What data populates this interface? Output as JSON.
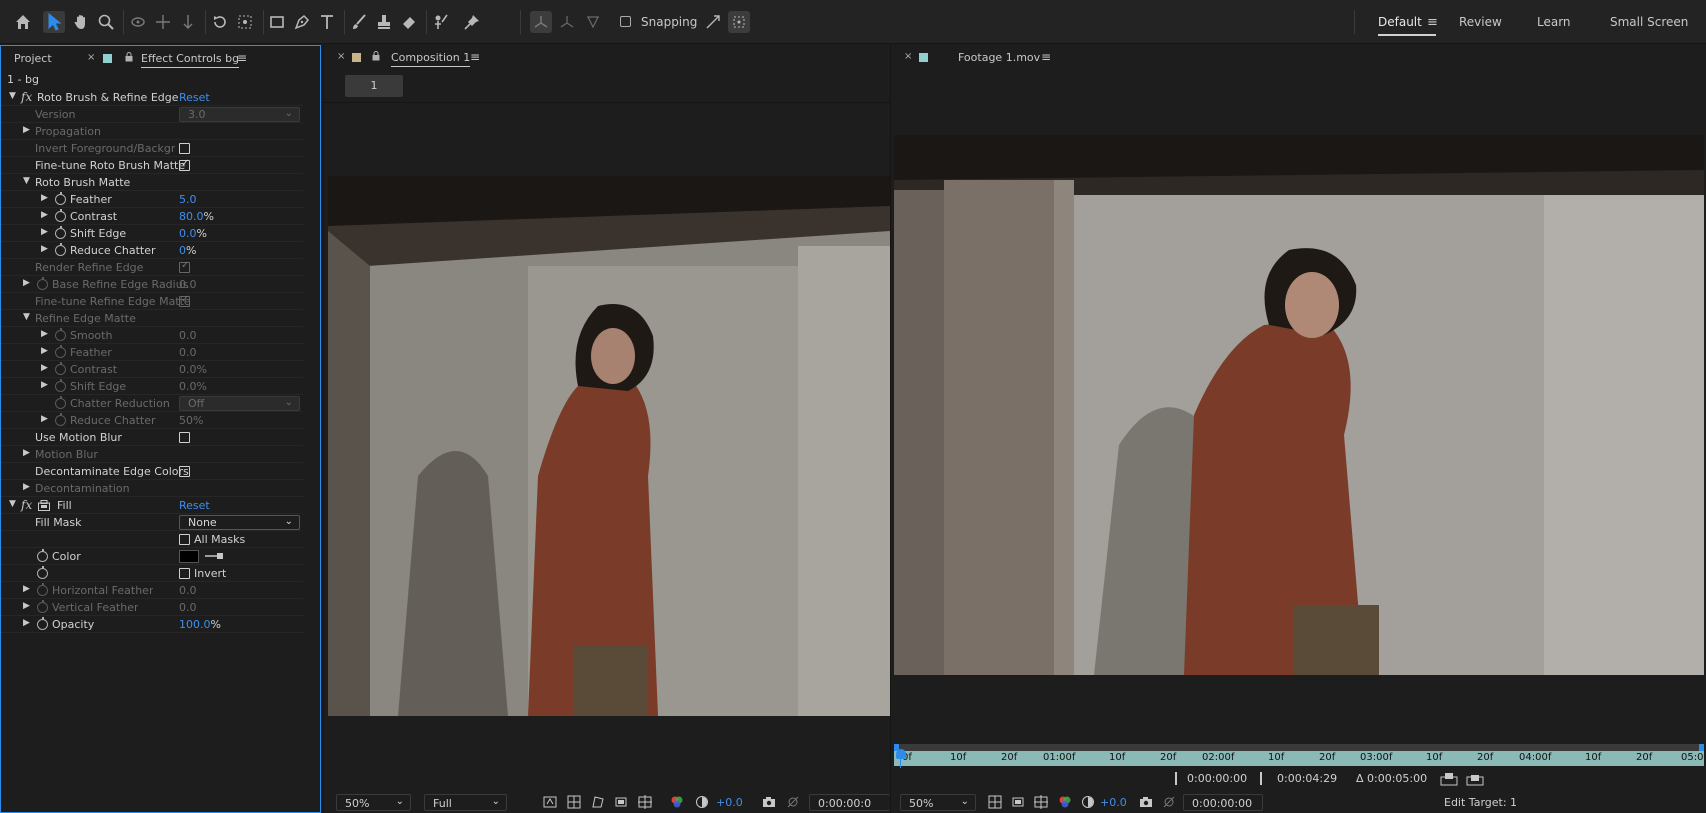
{
  "toolbar": {
    "snapping_label": "Snapping",
    "workspaces": [
      "Default",
      "Review",
      "Learn",
      "Small Screen"
    ]
  },
  "project_tab": "Project",
  "effect_tab": "Effect Controls bg",
  "layer_name": "1 - bg",
  "effect_rows": [
    {
      "label": "Roto Brush & Refine Edge",
      "reset": "Reset"
    },
    {
      "label": "Version",
      "value": "3.0"
    },
    {
      "label": "Propagation"
    },
    {
      "label": "Invert Foreground/Backgrou"
    },
    {
      "label": "Fine-tune Roto Brush Matte"
    },
    {
      "label": "Roto Brush Matte"
    },
    {
      "label": "Feather",
      "value": "5.0"
    },
    {
      "label": "Contrast",
      "value": "80.0",
      "unit": "%"
    },
    {
      "label": "Shift Edge",
      "value": "0.0",
      "unit": "%"
    },
    {
      "label": "Reduce Chatter",
      "value": "0",
      "unit": "%"
    },
    {
      "label": "Render Refine Edge"
    },
    {
      "label": "Base Refine Edge Radius",
      "value": "0.0"
    },
    {
      "label": "Fine-tune Refine Edge Matte"
    },
    {
      "label": "Refine Edge Matte"
    },
    {
      "label": "Smooth",
      "value": "0.0"
    },
    {
      "label": "Feather",
      "value": "0.0"
    },
    {
      "label": "Contrast",
      "value": "0.0%"
    },
    {
      "label": "Shift Edge",
      "value": "0.0%"
    },
    {
      "label": "Chatter Reduction",
      "value": "Off"
    },
    {
      "label": "Reduce Chatter",
      "value": "50%"
    },
    {
      "label": "Use Motion Blur"
    },
    {
      "label": "Motion Blur"
    },
    {
      "label": "Decontaminate Edge Colors"
    },
    {
      "label": "Decontamination"
    },
    {
      "label": "Fill",
      "reset": "Reset"
    },
    {
      "label": "Fill Mask",
      "value": "None"
    },
    {
      "label": "All Masks"
    },
    {
      "label": "Color"
    },
    {
      "label": "Invert"
    },
    {
      "label": "Horizontal Feather",
      "value": "0.0"
    },
    {
      "label": "Vertical Feather",
      "value": "0.0"
    },
    {
      "label": "Opacity",
      "value": "100.0",
      "unit": "%"
    }
  ],
  "comp": {
    "tab": "Composition 1",
    "breadcrumb": "1",
    "zoom": "50%",
    "resolution": "Full",
    "exposure": "+0.0",
    "timecode": "0:00:00:0"
  },
  "footage": {
    "tab": "Footage 1.mov",
    "ruler_labels": [
      "0f",
      "10f",
      "20f",
      "01:00f",
      "10f",
      "20f",
      "02:00f",
      "10f",
      "20f",
      "03:00f",
      "10f",
      "20f",
      "04:00f",
      "10f",
      "20f",
      "05:0"
    ],
    "in_point": "0:00:00:00",
    "out_point": "0:00:04:29",
    "duration": "Δ 0:00:05:00",
    "zoom": "50%",
    "exposure": "+0.0",
    "timecode": "0:00:00:00",
    "edit_target": "Edit Target: 1"
  },
  "colors": {
    "accent": "#2d8ceb",
    "link": "#3e8ff0",
    "ruler": "#8bbab6"
  }
}
